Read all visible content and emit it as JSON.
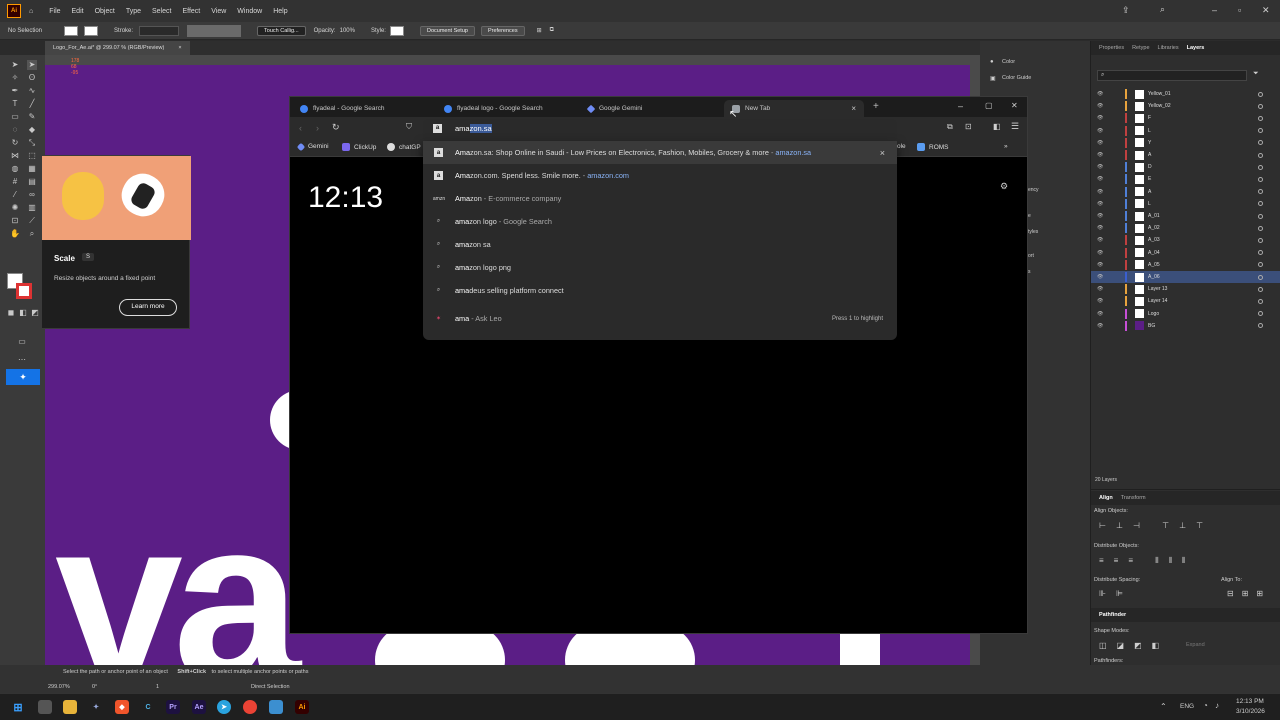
{
  "illustrator": {
    "logo": "Ai",
    "menu": [
      "File",
      "Edit",
      "Object",
      "Type",
      "Select",
      "Effect",
      "View",
      "Window",
      "Help"
    ],
    "control_bar": {
      "selection": "No Selection",
      "stroke_label": "Stroke:",
      "brush": "Touch Callig...",
      "opacity_label": "Opacity:",
      "opacity_value": "100%",
      "style_label": "Style:",
      "document_setup": "Document Setup",
      "preferences": "Preferences"
    },
    "doc_tab": "Logo_For_Ae.ai* @ 299.07 % (RGB/Preview)",
    "doc_tab_close": "×",
    "color_panel": {
      "color": "Color",
      "color_guide": "Color Guide"
    },
    "side_labels": [
      "ency",
      "e",
      "tyles",
      "ort",
      "s"
    ],
    "panel_tabs": [
      "Properties",
      "Retype",
      "Libraries",
      "Layers"
    ],
    "layers": [
      "Yellow_01",
      "Yellow_02",
      "F",
      "L",
      "Y",
      "A",
      "D",
      "E",
      "A",
      "L",
      "A_01",
      "A_02",
      "A_03",
      "A_04",
      "A_05",
      "A_06",
      "Layer 13",
      "Layer 14",
      "Logo",
      "BG"
    ],
    "layer_colors": [
      "#e8a33d",
      "#e8a33d",
      "#c04040",
      "#c04040",
      "#c04040",
      "#c04040",
      "#4f7fd6",
      "#4f7fd6",
      "#4f7fd6",
      "#4f7fd6",
      "#4f7fd6",
      "#4f7fd6",
      "#c04040",
      "#c04040",
      "#c04040",
      "#3a5fd0",
      "#e8a33d",
      "#e8a33d",
      "#c74fd6",
      "#c74fd6"
    ],
    "layers_count": "20 Layers",
    "align": {
      "tabs": [
        "Align",
        "Transform"
      ],
      "align_objects": "Align Objects:",
      "distribute_objects": "Distribute Objects:",
      "distribute_spacing": "Distribute Spacing:",
      "align_to": "Align To:"
    },
    "pathfinder": {
      "tab": "Pathfinder",
      "shape_modes": "Shape Modes:",
      "expand": "Expand",
      "pathfinders": "Pathfinders:"
    },
    "status": {
      "hint": "Select the path or anchor point of an object",
      "hint_bold": "Shift+Click",
      "hint_rest": "to select multiple anchor points or paths",
      "zoom": "299.07%",
      "rotation": "0°",
      "artboard_num": "1",
      "mode": "Direct Selection"
    },
    "tooltip": {
      "title": "Scale",
      "shortcut": "S",
      "desc": "Resize objects around a fixed point",
      "button": "Learn more"
    },
    "info_numbers": [
      "178",
      "68",
      "-95"
    ]
  },
  "browser": {
    "tabs": [
      {
        "label": "flyadeal - Google Search",
        "fav_color": "#4285f4"
      },
      {
        "label": "flyadeal logo - Google Search",
        "fav_color": "#4285f4"
      },
      {
        "label": "Google Gemini",
        "fav_color": "#6f8cf5"
      },
      {
        "label": "New Tab",
        "fav_color": "#9aa0a6"
      }
    ],
    "new_tab_symbol": "+",
    "address": {
      "typed": "ama",
      "completion": "zon.sa"
    },
    "bookmarks": [
      "Gemini",
      "ClickUp",
      "chatGP",
      "ole",
      "ROMS"
    ],
    "clock": "12:13",
    "suggestions": [
      {
        "icon": "a",
        "bold": "Ama",
        "text": "zon.sa: Shop Online in Saudi - Low Prices on Electronics, Fashion, Mobiles, Grocery & more",
        "sep": " - ",
        "domain": "amazon.sa",
        "type": "site"
      },
      {
        "icon": "a",
        "bold": "Ama",
        "text": "zon.com. Spend less. Smile more.",
        "sep": " - ",
        "domain": "amazon.com",
        "type": "site"
      },
      {
        "icon": "amazon",
        "bold": "Ama",
        "text": "zon",
        "sep": " - ",
        "domain": "E-commerce company",
        "type": "entity"
      },
      {
        "icon": "search",
        "bold": "ama",
        "text": "zon logo",
        "sep": " - ",
        "domain": "Google Search",
        "type": "search"
      },
      {
        "icon": "search",
        "bold": "ama",
        "text": "zon sa",
        "sep": "",
        "domain": "",
        "type": "search"
      },
      {
        "icon": "search",
        "bold": "ama",
        "text": "zon logo png",
        "sep": "",
        "domain": "",
        "type": "search"
      },
      {
        "icon": "search",
        "bold": "ama",
        "text": "deus selling platform connect",
        "sep": "",
        "domain": "",
        "type": "search"
      },
      {
        "icon": "leo",
        "bold": "ama",
        "text": "",
        "sep": " - ",
        "domain": "Ask Leo",
        "type": "leo"
      }
    ],
    "leo_hint": "Press 1 to highlight",
    "remove_symbol": "×"
  },
  "taskbar": {
    "apps": [
      "Pr",
      "Ae",
      "Ai"
    ],
    "lang": "ENG",
    "time": "12:13 PM",
    "date": "3/10/2026"
  }
}
